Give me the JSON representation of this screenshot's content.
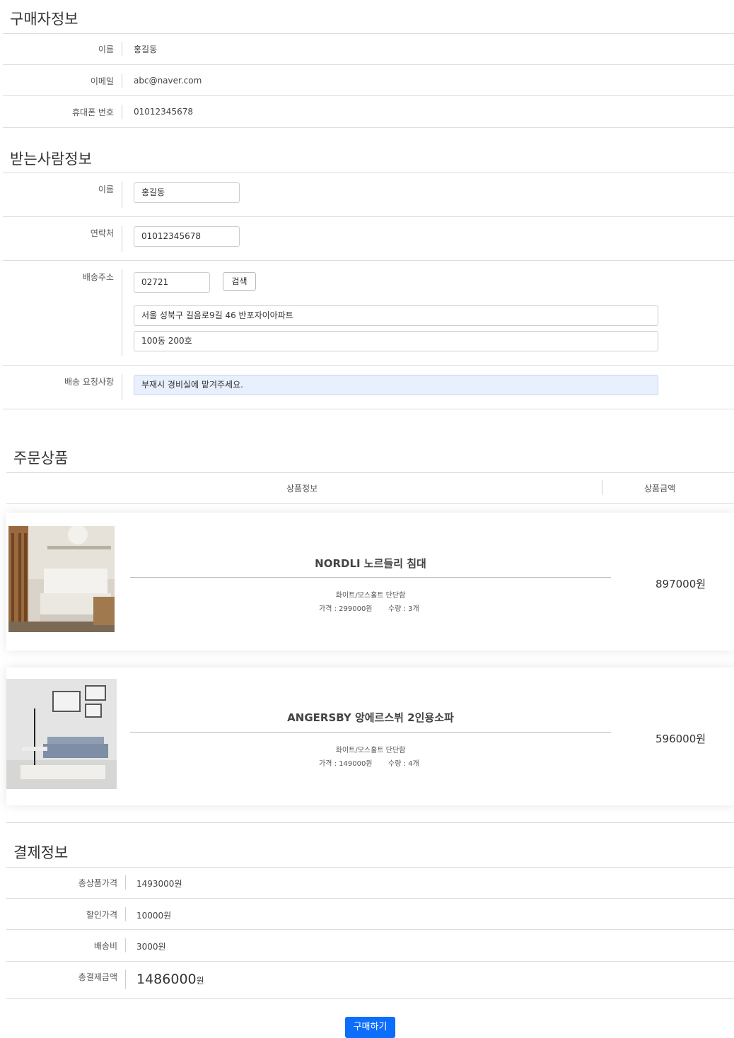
{
  "buyer": {
    "title": "구매자정보",
    "rows": [
      {
        "label": "이름",
        "value": "홍길동"
      },
      {
        "label": "이메일",
        "value": "abc@naver.com"
      },
      {
        "label": "휴대폰 번호",
        "value": "01012345678"
      }
    ]
  },
  "receiver": {
    "title": "받는사람정보",
    "name_label": "이름",
    "name_value": "홍길동",
    "phone_label": "연락처",
    "phone_value": "01012345678",
    "address_label": "배송주소",
    "zipcode": "02721",
    "search_button": "검색",
    "address1": "서울 성북구 길음로9길 46 반포자이아파트",
    "address2": "100동 200호",
    "request_label": "배송 요청사항",
    "request_value": "부재시 경비실에 맡겨주세요."
  },
  "order": {
    "title": "주문상품",
    "col_info": "상품정보",
    "col_amount": "상품금액",
    "items": [
      {
        "name": "NORDLI 노르들리 침대",
        "option": "화이트/모스홀트 단단함",
        "price_text": "가격 : 299000원",
        "qty_text": "수량 : 3개",
        "total": "897000원"
      },
      {
        "name": "ANGERSBY 앙에르스뷔 2인용소파",
        "option": "화이트/모스홀트 단단함",
        "price_text": "가격 : 149000원",
        "qty_text": "수량 : 4개",
        "total": "596000원"
      }
    ]
  },
  "payment": {
    "title": "결제정보",
    "rows": [
      {
        "label": "총상품가격",
        "value": "1493000원"
      },
      {
        "label": "할인가격",
        "value": "10000원"
      },
      {
        "label": "배송비",
        "value": "3000원"
      }
    ],
    "total_label": "총결제금액",
    "total_number": "1486000",
    "total_unit": "원"
  },
  "buy_button": "구매하기",
  "colors": {
    "accent": "#0d6efd",
    "input_autofill": "#e8f0fe"
  }
}
